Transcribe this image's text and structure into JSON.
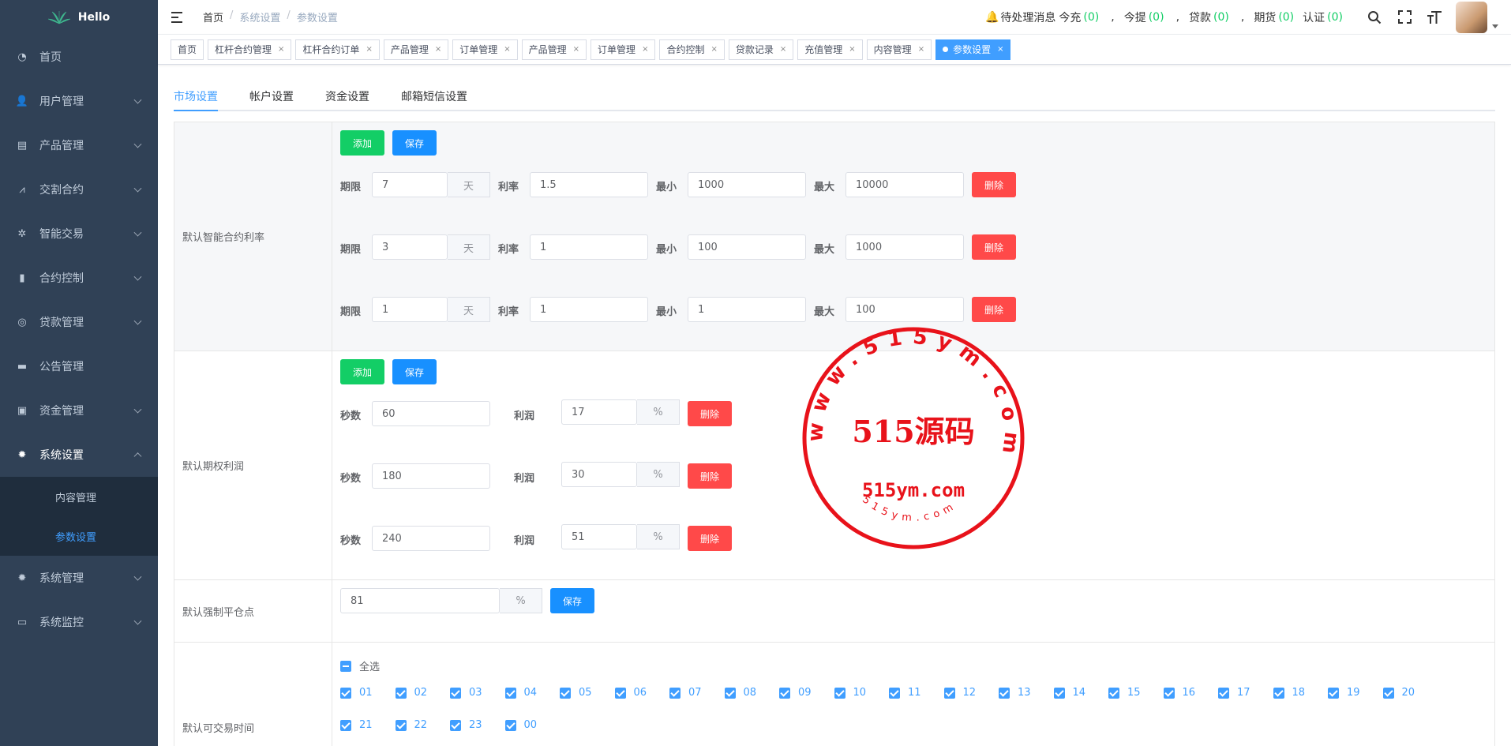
{
  "brand": {
    "name": "Hello"
  },
  "sidebar": {
    "items": [
      {
        "label": "首页",
        "icon": "dashboard-icon"
      },
      {
        "label": "用户管理",
        "icon": "user-icon"
      },
      {
        "label": "产品管理",
        "icon": "document-icon"
      },
      {
        "label": "交割合约",
        "icon": "chart-icon"
      },
      {
        "label": "智能交易",
        "icon": "gear-icon"
      },
      {
        "label": "合约控制",
        "icon": "bar-chart-icon"
      },
      {
        "label": "贷款管理",
        "icon": "coins-icon"
      },
      {
        "label": "公告管理",
        "icon": "message-icon"
      },
      {
        "label": "资金管理",
        "icon": "money-icon"
      },
      {
        "label": "系统设置",
        "icon": "settings-icon"
      },
      {
        "label": "系统管理",
        "icon": "settings-icon"
      },
      {
        "label": "系统监控",
        "icon": "monitor-icon"
      }
    ],
    "submenu": [
      "内容管理",
      "参数设置"
    ]
  },
  "header": {
    "breadcrumb": [
      "首页",
      "系统设置",
      "参数设置"
    ],
    "notice": "待处理消息",
    "counters": [
      {
        "label": "今充",
        "value": "(0)"
      },
      {
        "label": "今提",
        "value": "(0)"
      },
      {
        "label": "贷款",
        "value": "(0)"
      },
      {
        "label": "期货",
        "value": "(0)"
      },
      {
        "label": "认证",
        "value": "(0)"
      }
    ],
    "sep": ","
  },
  "tags": [
    "首页",
    "杠杆合约管理",
    "杠杆合约订单",
    "产品管理",
    "订单管理",
    "产品管理",
    "订单管理",
    "合约控制",
    "贷款记录",
    "充值管理",
    "内容管理",
    "参数设置"
  ],
  "tabs": [
    "市场设置",
    "帐户设置",
    "资金设置",
    "邮箱短信设置"
  ],
  "buttons": {
    "add": "添加",
    "save": "保存",
    "delete": "删除"
  },
  "contract_rates": {
    "label": "默认智能合约利率",
    "field_labels": {
      "period": "期限",
      "unit": "天",
      "rate": "利率",
      "min": "最小",
      "max": "最大"
    },
    "rows": [
      {
        "period": "7",
        "rate": "1.5",
        "min": "1000",
        "max": "10000"
      },
      {
        "period": "3",
        "rate": "1",
        "min": "100",
        "max": "1000"
      },
      {
        "period": "1",
        "rate": "1",
        "min": "1",
        "max": "100"
      }
    ]
  },
  "option_profit": {
    "label": "默认期权利润",
    "field_labels": {
      "seconds": "秒数",
      "profit": "利润",
      "unit": "%"
    },
    "rows": [
      {
        "seconds": "60",
        "profit": "17"
      },
      {
        "seconds": "180",
        "profit": "30"
      },
      {
        "seconds": "240",
        "profit": "51"
      }
    ]
  },
  "liquidation": {
    "label": "默认强制平仓点",
    "value": "81",
    "unit": "%"
  },
  "trading_time": {
    "label": "默认可交易时间",
    "select_all": "全选",
    "hours": [
      "01",
      "02",
      "03",
      "04",
      "05",
      "06",
      "07",
      "08",
      "09",
      "10",
      "11",
      "12",
      "13",
      "14",
      "15",
      "16",
      "17",
      "18",
      "19",
      "20",
      "21",
      "22",
      "23",
      "00"
    ]
  },
  "watermark": {
    "title": "515源码",
    "url": "515ym.com",
    "ring_text": "www.515ym.com",
    "bottom_text": "515ym.com",
    "color": "#e8121a"
  }
}
